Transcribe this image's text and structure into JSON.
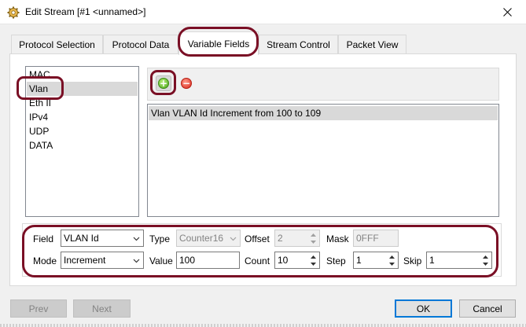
{
  "window": {
    "title": "Edit Stream [#1 <unnamed>]",
    "icon": "gear-app-icon",
    "close_icon": "close-icon"
  },
  "tabs": [
    {
      "label": "Protocol Selection",
      "active": false
    },
    {
      "label": "Protocol Data",
      "active": false
    },
    {
      "label": "Variable Fields",
      "active": true
    },
    {
      "label": "Stream Control",
      "active": false
    },
    {
      "label": "Packet View",
      "active": false
    }
  ],
  "protocols": {
    "items": [
      "MAC",
      "Vlan",
      "Eth II",
      "IPv4",
      "UDP",
      "DATA"
    ],
    "selected": "Vlan"
  },
  "toolbar": {
    "add_icon": "add-icon",
    "remove_icon": "remove-icon"
  },
  "variable_fields": {
    "rows": [
      "Vlan VLAN Id Increment from 100 to 109"
    ]
  },
  "editor": {
    "field_label": "Field",
    "field_value": "VLAN Id",
    "type_label": "Type",
    "type_value": "Counter16",
    "offset_label": "Offset",
    "offset_value": "2",
    "mask_label": "Mask",
    "mask_value": "0FFF",
    "mode_label": "Mode",
    "mode_value": "Increment",
    "value_label": "Value",
    "value_value": "100",
    "count_label": "Count",
    "count_value": "10",
    "step_label": "Step",
    "step_value": "1",
    "skip_label": "Skip",
    "skip_value": "1"
  },
  "buttons": {
    "prev": "Prev",
    "next": "Next",
    "ok": "OK",
    "cancel": "Cancel"
  },
  "colors": {
    "highlight": "#7a0f25",
    "selection": "#d9d9d9",
    "default_button_border": "#0078d7"
  }
}
